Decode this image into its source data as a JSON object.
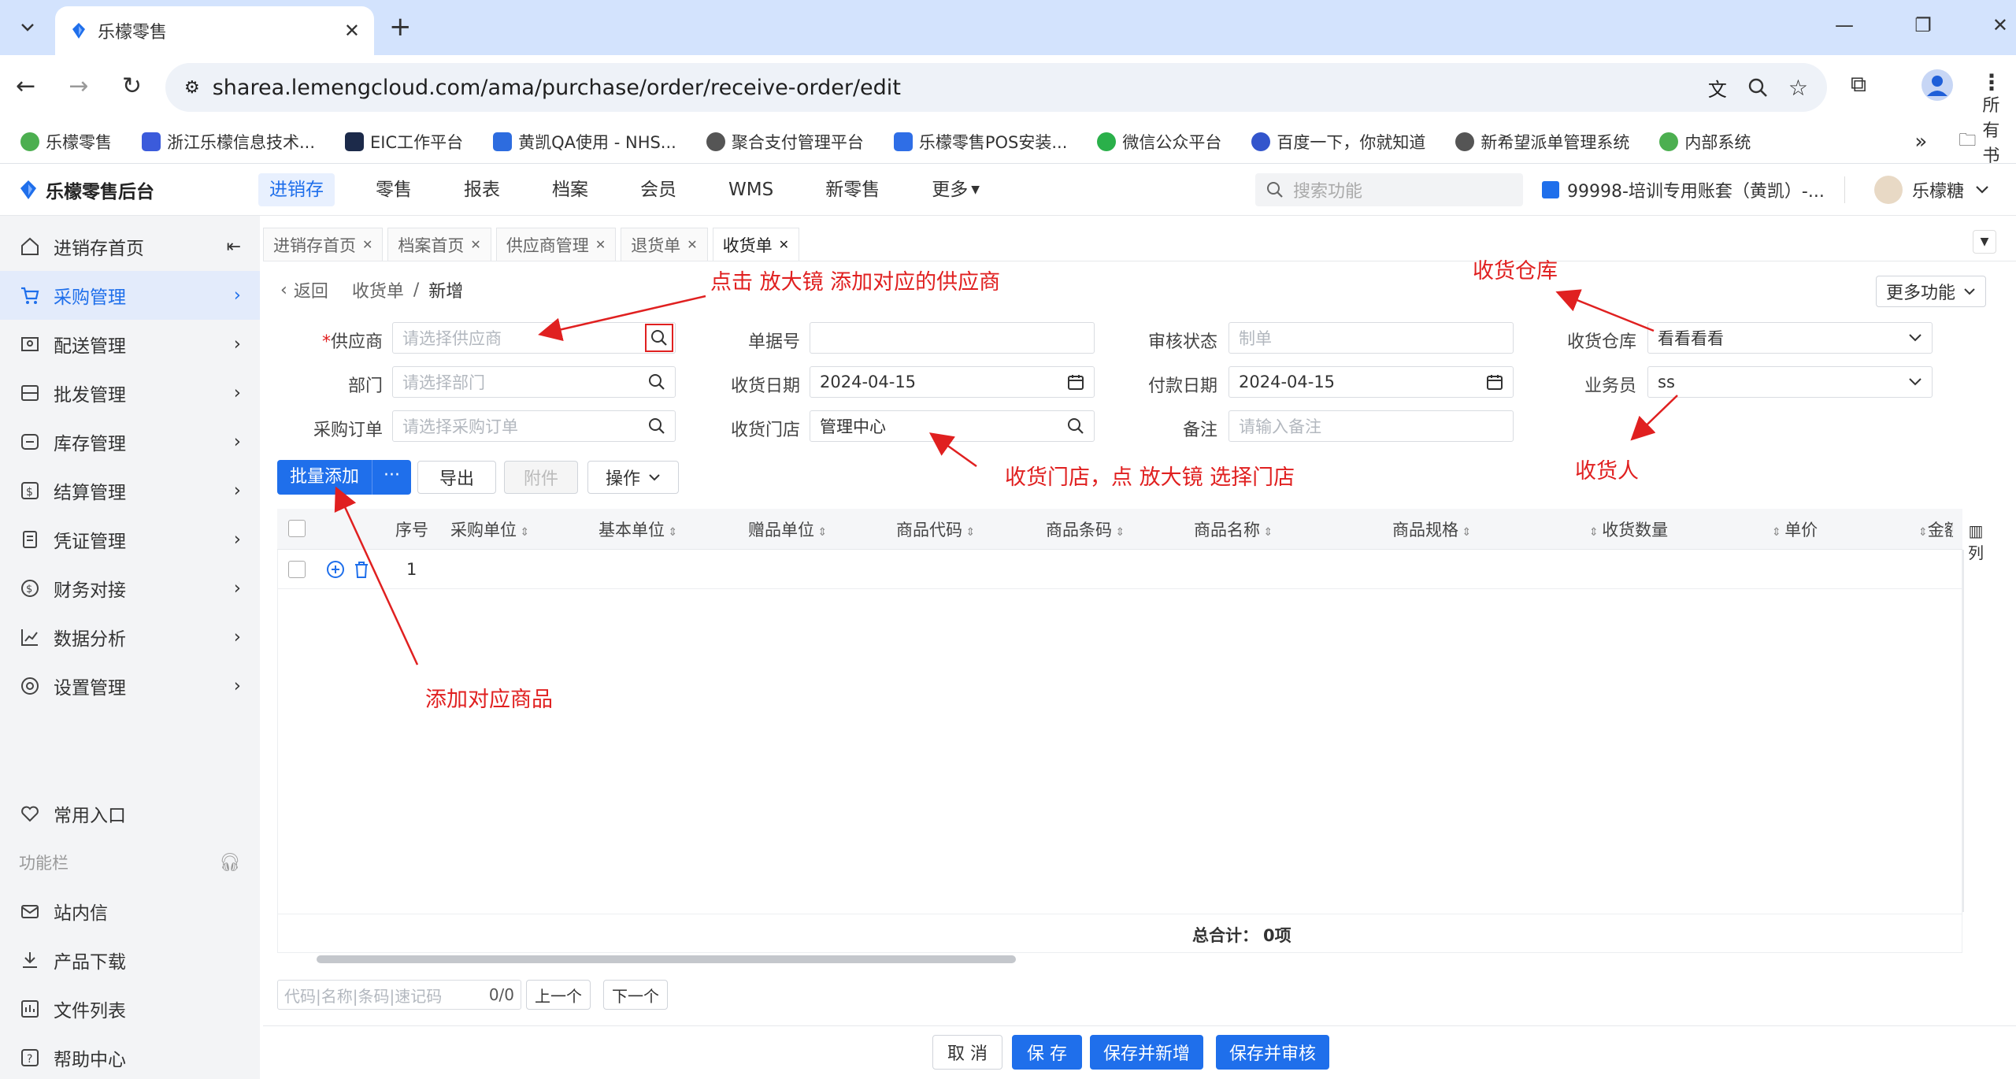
{
  "browser": {
    "tab_title": "乐檬零售",
    "url": "sharea.lemengcloud.com/ama/purchase/order/receive-order/edit",
    "bookmarks": [
      "乐檬零售",
      "浙江乐檬信息技术...",
      "EIC工作平台",
      "黄凯QA使用 - NHS...",
      "聚合支付管理平台",
      "乐檬零售POS安装...",
      "微信公众平台",
      "百度一下，你就知道",
      "新希望派单管理系统",
      "内部系统"
    ],
    "all_bookmarks": "所有书签"
  },
  "app": {
    "brand": "乐檬零售后台",
    "nav": [
      "进销存",
      "零售",
      "报表",
      "档案",
      "会员",
      "WMS",
      "新零售",
      "更多"
    ],
    "search_placeholder": "搜索功能",
    "account": "99998-培训专用账套（黄凯）-...",
    "user": "乐檬糖"
  },
  "sidebar": {
    "items": [
      "进销存首页",
      "采购管理",
      "配送管理",
      "批发管理",
      "库存管理",
      "结算管理",
      "凭证管理",
      "财务对接",
      "数据分析",
      "设置管理"
    ],
    "common": "常用入口",
    "section": "功能栏",
    "bottom": [
      "站内信",
      "产品下载",
      "文件列表",
      "帮助中心"
    ]
  },
  "tabs": [
    "进销存首页",
    "档案首页",
    "供应商管理",
    "退货单",
    "收货单"
  ],
  "breadcrumb": {
    "back": "返回",
    "parent": "收货单",
    "sep": "/",
    "current": "新增"
  },
  "more_functions": "更多功能",
  "form": {
    "supplier": {
      "label": "供应商",
      "placeholder": "请选择供应商"
    },
    "doc_no": {
      "label": "单据号",
      "value": ""
    },
    "audit_status": {
      "label": "审核状态",
      "placeholder": "制单"
    },
    "warehouse": {
      "label": "收货仓库",
      "value": "看看看看"
    },
    "dept": {
      "label": "部门",
      "placeholder": "请选择部门"
    },
    "receive_date": {
      "label": "收货日期",
      "value": "2024-04-15"
    },
    "pay_date": {
      "label": "付款日期",
      "value": "2024-04-15"
    },
    "salesman": {
      "label": "业务员",
      "value": "ss"
    },
    "po": {
      "label": "采购订单",
      "placeholder": "请选择采购订单"
    },
    "store": {
      "label": "收货门店",
      "value": "管理中心"
    },
    "remark": {
      "label": "备注",
      "placeholder": "请输入备注"
    }
  },
  "toolbar": {
    "batch_add": "批量添加",
    "more": "···",
    "export": "导出",
    "attach": "附件",
    "ops": "操作"
  },
  "table": {
    "headers": [
      "序号",
      "采购单位",
      "基本单位",
      "赠品单位",
      "商品代码",
      "商品条码",
      "商品名称",
      "商品规格",
      "收货数量",
      "单价",
      "金额"
    ],
    "col_setting": "列",
    "rows": [
      {
        "index": "1"
      }
    ],
    "total_label": "总合计：",
    "total_value": "0项"
  },
  "finder": {
    "placeholder": "代码|名称|条码|速记码",
    "count": "0/0",
    "prev": "上一个",
    "next": "下一个"
  },
  "footer": {
    "cancel": "取 消",
    "save": "保 存",
    "save_new": "保存并新增",
    "save_audit": "保存并审核"
  },
  "annotations": {
    "supplier": "点击 放大镜 添加对应的供应商",
    "warehouse": "收货仓库",
    "store": "收货门店，点 放大镜 选择门店",
    "receiver": "收货人",
    "goods": "添加对应商品"
  },
  "colors": {
    "accent": "#1f6feb",
    "annotation": "#e02020"
  }
}
